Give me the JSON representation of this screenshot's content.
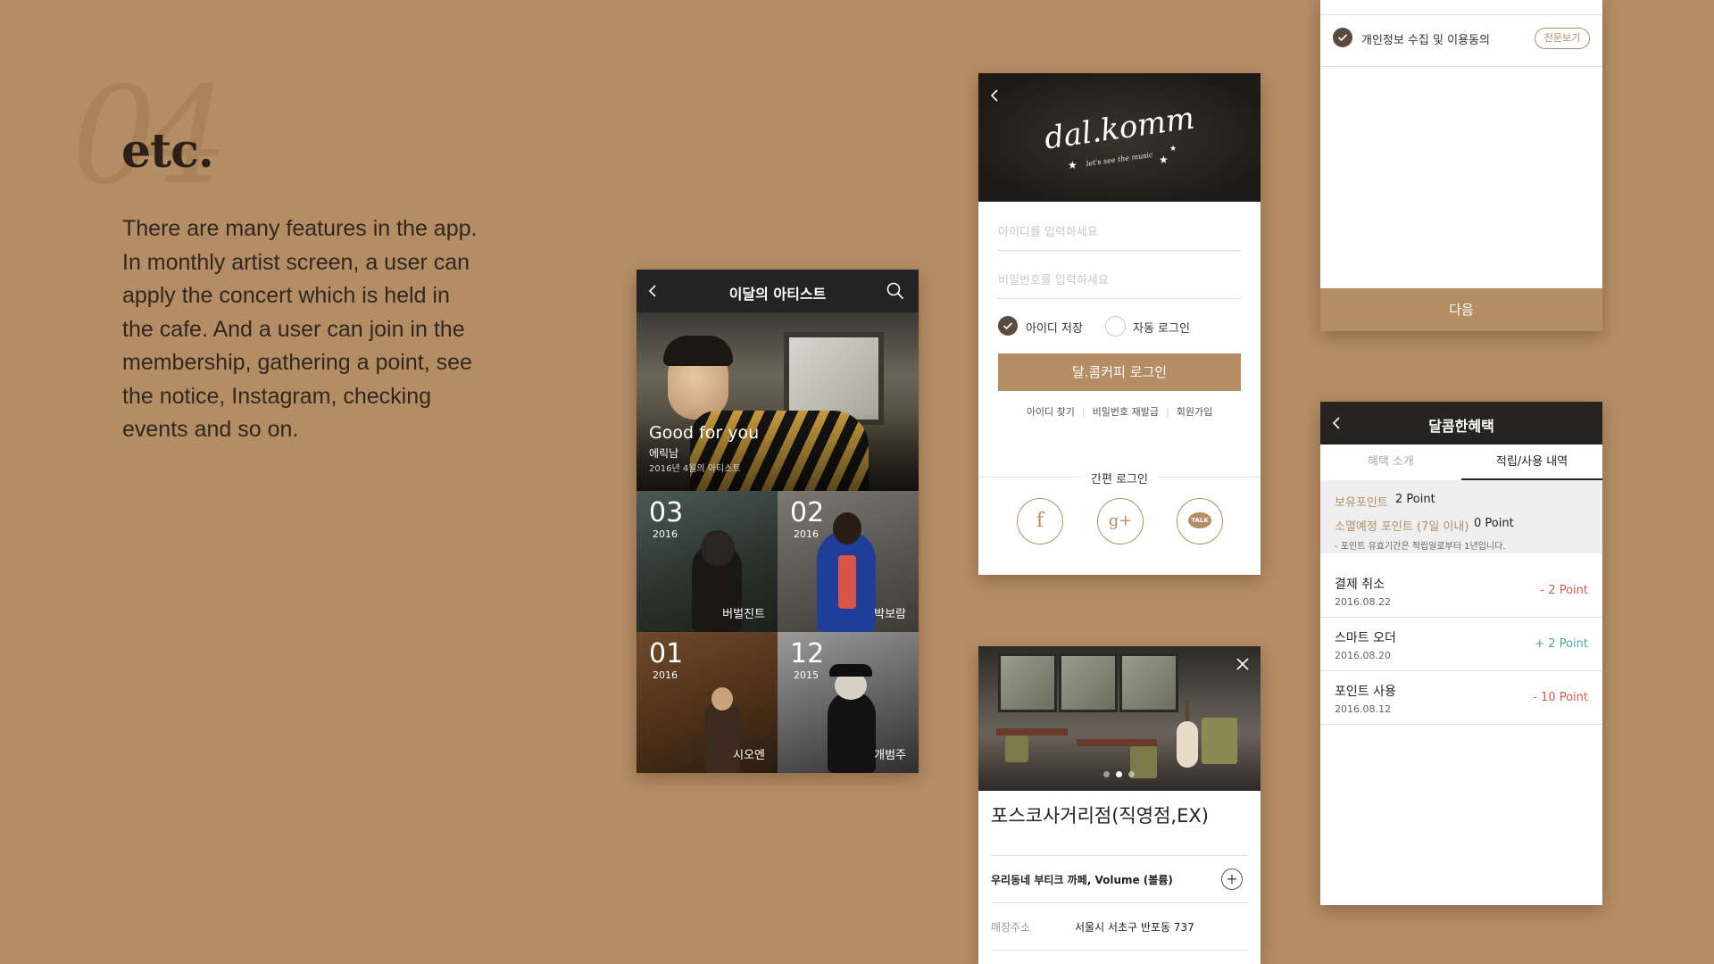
{
  "section": {
    "number": "04",
    "title": "etc.",
    "description_lines": [
      "There are many features in the app.",
      "In monthly artist screen, a user can",
      "apply the concert which is held in",
      "the cafe. And a user can join in the",
      "membership, gathering a point, see",
      "the notice, Instagram, checking",
      "events and so on."
    ]
  },
  "artists_screen": {
    "title": "이달의 아티스트",
    "hero": {
      "song": "Good for you",
      "artist": "에릭남",
      "subtitle": "2016년 4월의 아티스트"
    },
    "tiles": [
      {
        "month": "03",
        "year": "2016",
        "artist": "버벌진트"
      },
      {
        "month": "02",
        "year": "2016",
        "artist": "박보람"
      },
      {
        "month": "01",
        "year": "2016",
        "artist": "시오엔"
      },
      {
        "month": "12",
        "year": "2015",
        "artist": "개범주"
      }
    ]
  },
  "login_screen": {
    "logo": "dal.komm",
    "logo_sub": "let's see the music",
    "id_placeholder": "아이디를 입력하세요",
    "pw_placeholder": "비밀번호를 입력하세요",
    "save_id": "아이디 저장",
    "auto_login": "자동 로그인",
    "login_button": "달.콤커피 로그인",
    "links": [
      "아이디 찾기",
      "비밀번호 재발급",
      "회원가입"
    ],
    "simple_login": "간편 로그인",
    "social": {
      "facebook": "f",
      "google": "g+",
      "kakao": "TALK"
    }
  },
  "store_screen": {
    "name": "포스코사거리점(직영점,EX)",
    "description": "우리동네 부티크 까페, Volume (볼륨)",
    "address_label": "매장주소",
    "address": "서울시 서초구 반포동 737"
  },
  "terms_screen": {
    "agreement": "개인정보 수집 및 이용동의",
    "view_full": "전문보기",
    "next": "다음"
  },
  "benefits_screen": {
    "title": "달콤한혜택",
    "tabs": [
      "혜택 소개",
      "적립/사용 내역"
    ],
    "held_label": "보유포인트",
    "held_value": "2 Point",
    "expiring_label": "소멸예정 포인트 (7일 이내)",
    "expiring_value": "0 Point",
    "note": "- 포인트 유효기간은 적립일로부터 1년입니다.",
    "history": [
      {
        "title": "결제 취소",
        "date": "2016.08.22",
        "value": "- 2 Point",
        "color": "#e0574b"
      },
      {
        "title": "스마트 오더",
        "date": "2016.08.20",
        "value": "+ 2 Point",
        "color": "#4aa8a0"
      },
      {
        "title": "포인트 사용",
        "date": "2016.08.12",
        "value": "- 10 Point",
        "color": "#e0574b"
      }
    ]
  },
  "colors": {
    "background": "#b58d65",
    "accent": "#b58d65",
    "dark": "#262421"
  }
}
